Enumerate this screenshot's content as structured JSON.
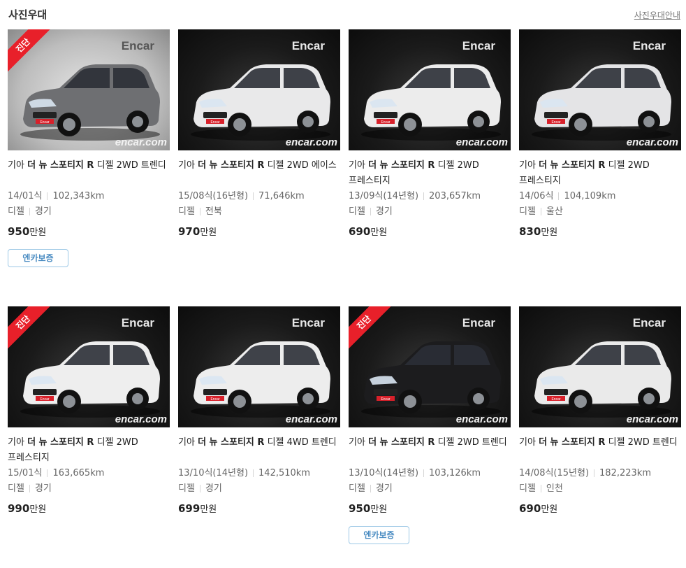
{
  "header": {
    "title": "사진우대",
    "guide_link": "사진우대안내"
  },
  "listings": [
    {
      "brand": "기아",
      "model": "더 뉴 스포티지 R",
      "trim": "디젤 2WD 트렌디",
      "year": "14/01식",
      "mileage": "102,343km",
      "fuel": "디젤",
      "region": "경기",
      "price": "950",
      "price_unit": "만원",
      "diagnosed": true,
      "diag_label": "진단",
      "badge": "엔카보증",
      "car_color": "#6e6f72",
      "bg": "light"
    },
    {
      "brand": "기아",
      "model": "더 뉴 스포티지 R",
      "trim": "디젤 2WD 에이스",
      "year": "15/08식(16년형)",
      "mileage": "71,646km",
      "fuel": "디젤",
      "region": "전북",
      "price": "970",
      "price_unit": "만원",
      "diagnosed": false,
      "car_color": "#e9e9ea",
      "bg": "dark"
    },
    {
      "brand": "기아",
      "model": "더 뉴 스포티지 R",
      "trim": "디젤 2WD 프레스티지",
      "year": "13/09식(14년형)",
      "mileage": "203,657km",
      "fuel": "디젤",
      "region": "경기",
      "price": "690",
      "price_unit": "만원",
      "diagnosed": false,
      "car_color": "#ececec",
      "bg": "dark"
    },
    {
      "brand": "기아",
      "model": "더 뉴 스포티지 R",
      "trim": "디젤 2WD 프레스티지",
      "year": "14/06식",
      "mileage": "104,109km",
      "fuel": "디젤",
      "region": "울산",
      "price": "830",
      "price_unit": "만원",
      "diagnosed": false,
      "car_color": "#e4e4e6",
      "bg": "dark"
    },
    {
      "brand": "기아",
      "model": "더 뉴 스포티지 R",
      "trim": "디젤 2WD 프레스티지",
      "year": "15/01식",
      "mileage": "163,665km",
      "fuel": "디젤",
      "region": "경기",
      "price": "990",
      "price_unit": "만원",
      "diagnosed": true,
      "diag_label": "진단",
      "car_color": "#eeeeee",
      "bg": "dark"
    },
    {
      "brand": "기아",
      "model": "더 뉴 스포티지 R",
      "trim": "디젤 4WD 트렌디",
      "year": "13/10식(14년형)",
      "mileage": "142,510km",
      "fuel": "디젤",
      "region": "경기",
      "price": "699",
      "price_unit": "만원",
      "diagnosed": false,
      "car_color": "#ededed",
      "bg": "dark"
    },
    {
      "brand": "기아",
      "model": "더 뉴 스포티지 R",
      "trim": "디젤 2WD 트렌디",
      "year": "13/10식(14년형)",
      "mileage": "103,126km",
      "fuel": "디젤",
      "region": "경기",
      "price": "950",
      "price_unit": "만원",
      "diagnosed": true,
      "diag_label": "진단",
      "badge": "엔카보증",
      "car_color": "#1c1c1e",
      "bg": "dark"
    },
    {
      "brand": "기아",
      "model": "더 뉴 스포티지 R",
      "trim": "디젤 2WD 트렌디",
      "year": "14/08식(15년형)",
      "mileage": "182,223km",
      "fuel": "디젤",
      "region": "인천",
      "price": "690",
      "price_unit": "만원",
      "diagnosed": false,
      "car_color": "#eaeaea",
      "bg": "dark"
    }
  ],
  "watermark": {
    "top": "Encar",
    "bottom": "encar.com",
    "plate": "Encar"
  },
  "colors": {
    "ribbon": "#e8202a",
    "badge_border": "#9cc8e6",
    "badge_text": "#4a8cc2"
  }
}
